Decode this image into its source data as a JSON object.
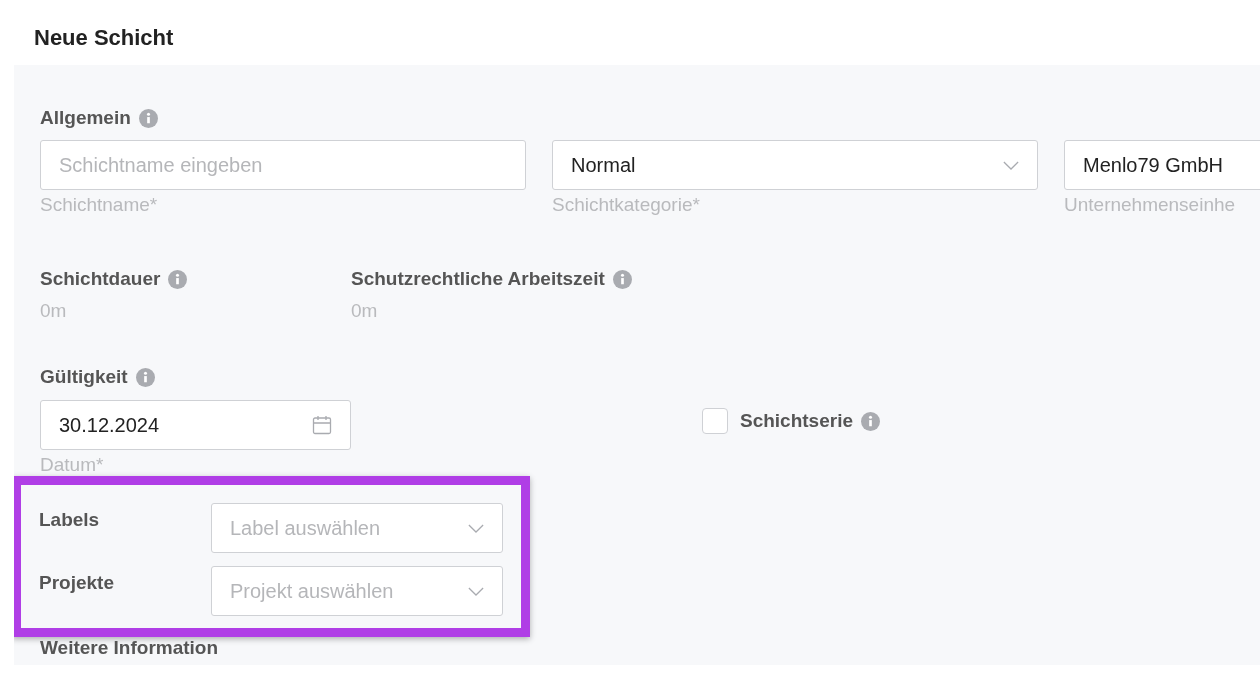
{
  "title": "Neue Schicht",
  "general": {
    "heading": "Allgemein",
    "fields": [
      {
        "kind": "input",
        "placeholder": "Schichtname eingeben",
        "helper": "Schichtname*"
      },
      {
        "kind": "select",
        "value": "Normal",
        "helper": "Schichtkategorie*"
      },
      {
        "kind": "text",
        "value": "Menlo79 GmbH",
        "helper": "Unternehmenseinhe"
      }
    ]
  },
  "durations": [
    {
      "label": "Schichtdauer",
      "value": "0m"
    },
    {
      "label": "Schutzrechtliche Arbeitszeit",
      "value": "0m"
    }
  ],
  "validity": {
    "label": "Gültigkeit",
    "date": "30.12.2024",
    "helper": "Datum*"
  },
  "series": {
    "label": "Schichtserie",
    "checked": false
  },
  "pickers": [
    {
      "label": "Labels",
      "placeholder": "Label auswählen"
    },
    {
      "label": "Projekte",
      "placeholder": "Projekt auswählen"
    }
  ],
  "next_section": "Weitere Information"
}
